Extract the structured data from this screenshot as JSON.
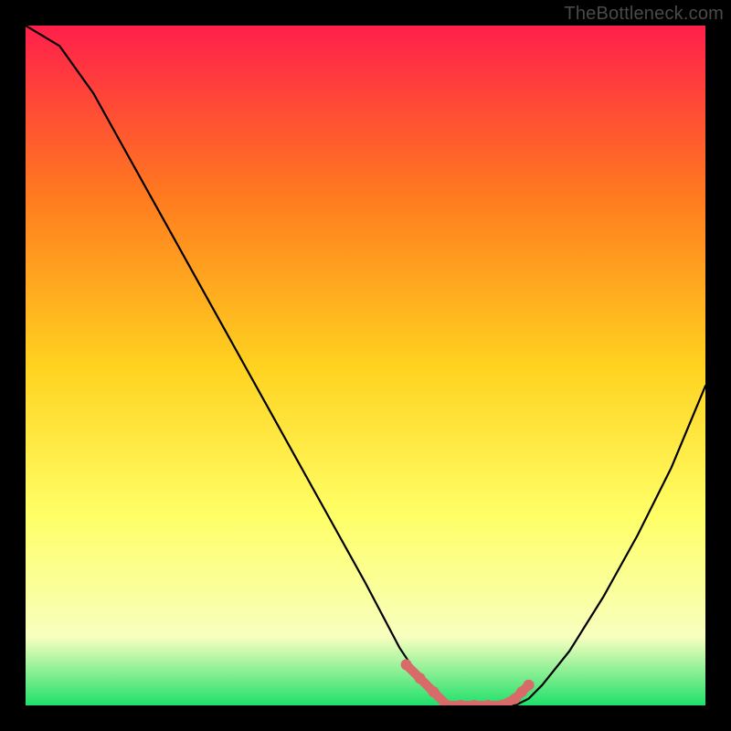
{
  "watermark": "TheBottleneck.com",
  "colors": {
    "page_background": "#000000",
    "gradient_top": "#ff1f4b",
    "gradient_mid_upper": "#ff7a1f",
    "gradient_mid": "#ffd21f",
    "gradient_mid_lower": "#ffff66",
    "gradient_lower": "#f7ffbf",
    "gradient_bottom": "#1fe06a",
    "curve_stroke": "#000000",
    "marker_fill": "#d96a6a"
  },
  "chart_data": {
    "type": "line",
    "title": "",
    "xlabel": "",
    "ylabel": "",
    "x": [
      0.0,
      0.05,
      0.1,
      0.15,
      0.2,
      0.25,
      0.3,
      0.35,
      0.4,
      0.45,
      0.5,
      0.55,
      0.58,
      0.6,
      0.62,
      0.64,
      0.66,
      0.68,
      0.7,
      0.72,
      0.74,
      0.76,
      0.8,
      0.85,
      0.9,
      0.95,
      1.0
    ],
    "values": [
      1.0,
      0.97,
      0.9,
      0.81,
      0.72,
      0.63,
      0.54,
      0.45,
      0.36,
      0.27,
      0.18,
      0.085,
      0.04,
      0.02,
      0.0,
      0.0,
      0.0,
      0.0,
      0.0,
      0.0,
      0.01,
      0.03,
      0.08,
      0.16,
      0.25,
      0.35,
      0.47
    ],
    "xlim": [
      0,
      1
    ],
    "ylim": [
      0,
      1
    ],
    "markers": {
      "x": [
        0.56,
        0.58,
        0.6,
        0.62,
        0.64,
        0.66,
        0.68,
        0.7,
        0.72,
        0.73,
        0.74
      ],
      "y": [
        0.06,
        0.04,
        0.02,
        0.0,
        0.0,
        0.0,
        0.0,
        0.0,
        0.01,
        0.02,
        0.03
      ]
    }
  }
}
